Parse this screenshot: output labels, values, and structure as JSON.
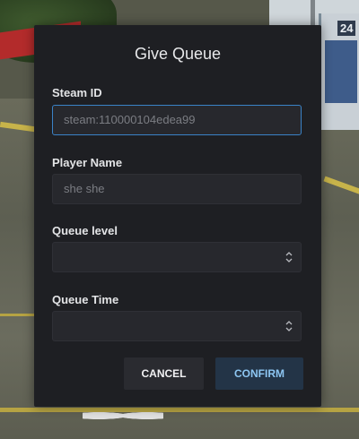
{
  "dialog": {
    "title": "Give Queue",
    "steam_id": {
      "label": "Steam ID",
      "value": "steam:110000104edea99"
    },
    "player_name": {
      "label": "Player Name",
      "value": "she she"
    },
    "queue_level": {
      "label": "Queue level",
      "value": ""
    },
    "queue_time": {
      "label": "Queue Time",
      "value": ""
    },
    "cancel_label": "CANCEL",
    "confirm_label": "CONFIRM"
  },
  "background": {
    "bus_number": "24"
  },
  "colors": {
    "dialog_bg": "#1e1f23",
    "focus_border": "#3a82c6",
    "confirm_text": "#8dc6f2"
  }
}
